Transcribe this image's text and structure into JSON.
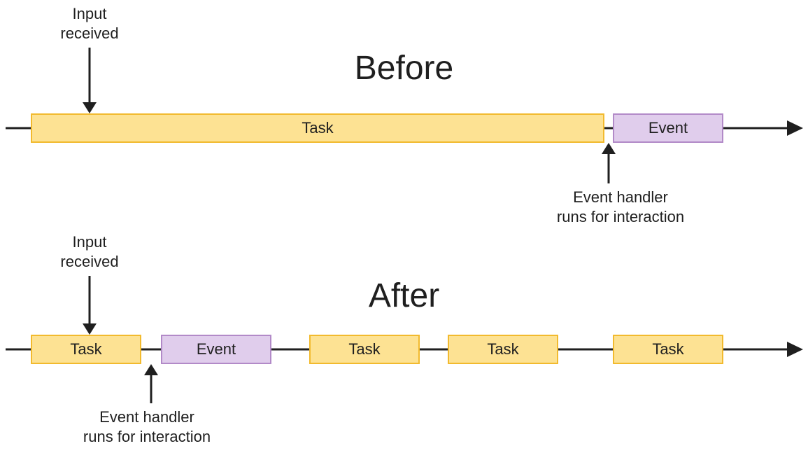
{
  "before": {
    "title": "Before",
    "input_label": "Input\nreceived",
    "handler_label": "Event handler\nruns for interaction",
    "blocks": {
      "task": "Task",
      "event": "Event"
    }
  },
  "after": {
    "title": "After",
    "input_label": "Input\nreceived",
    "handler_label": "Event handler\nruns for interaction",
    "blocks": {
      "task1": "Task",
      "event": "Event",
      "task2": "Task",
      "task3": "Task",
      "task4": "Task"
    }
  },
  "colors": {
    "task_fill": "#fde293",
    "task_stroke": "#f2ba2e",
    "event_fill": "#e0cdec",
    "event_stroke": "#b28ac8",
    "line": "#1f1f1f"
  }
}
